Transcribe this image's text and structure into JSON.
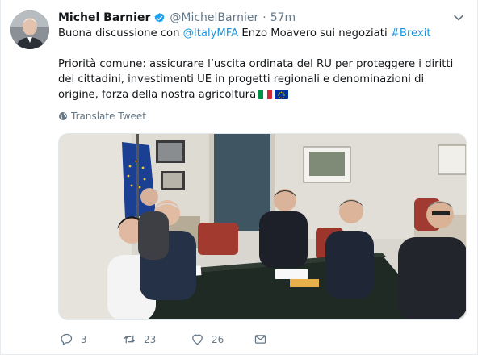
{
  "tweet": {
    "author_name": "Michel Barnier",
    "author_handle": "@MichelBarnier",
    "separator": "·",
    "time": "57m",
    "line1_prefix": "Buona discussione con ",
    "mention": "@ItalyMFA",
    "line1_middle": " Enzo Moavero sui negoziati ",
    "hashtag": "#Brexit",
    "paragraph2": "Priorità comune: assicurare l’uscita ordinata del RU per proteggere i diritti dei cittadini, investimenti UE in progetti regionali e denominazioni di origine, forza della nostra agricoltura",
    "translate_label": "Translate Tweet",
    "flags": [
      "italy-flag",
      "eu-flag"
    ]
  },
  "actions": {
    "replies": "3",
    "retweets": "23",
    "likes": "26"
  },
  "colors": {
    "link": "#1b95e0",
    "muted": "#657786",
    "verified": "#1da1f2"
  }
}
